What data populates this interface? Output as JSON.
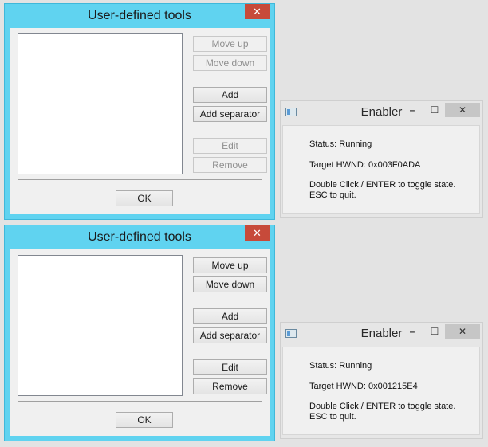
{
  "dialogs": [
    {
      "title": "User-defined tools",
      "close_glyph": "✕",
      "buttons": {
        "move_up": "Move up",
        "move_down": "Move down",
        "add": "Add",
        "add_separator": "Add separator",
        "edit": "Edit",
        "remove": "Remove",
        "ok": "OK"
      }
    },
    {
      "title": "User-defined tools",
      "close_glyph": "✕",
      "buttons": {
        "move_up": "Move up",
        "move_down": "Move down",
        "add": "Add",
        "add_separator": "Add separator",
        "edit": "Edit",
        "remove": "Remove",
        "ok": "OK"
      }
    }
  ],
  "enablers": [
    {
      "title": "Enabler",
      "minimize_glyph": "–",
      "maximize_glyph": "☐",
      "close_glyph": "✕",
      "status": "Status: Running",
      "target_hwnd": "Target HWND: 0x003F0ADA",
      "hint_line1": "Double Click / ENTER to toggle state.",
      "hint_line2": "ESC to quit."
    },
    {
      "title": "Enabler",
      "minimize_glyph": "–",
      "maximize_glyph": "☐",
      "close_glyph": "✕",
      "status": "Status: Running",
      "target_hwnd": "Target HWND: 0x001215E4",
      "hint_line1": "Double Click / ENTER to toggle state.",
      "hint_line2": "ESC to quit."
    }
  ],
  "colors": {
    "dialog_frame": "#60d3f0",
    "close_button": "#c74a3a"
  }
}
